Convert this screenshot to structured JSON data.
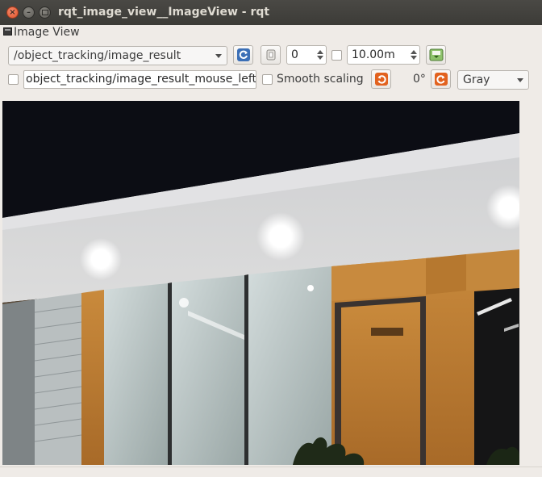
{
  "window": {
    "title": "rqt_image_view__ImageView - rqt",
    "close_glyph": "×",
    "minimize_glyph": "–"
  },
  "dock": {
    "title": "Image View"
  },
  "toolbar": {
    "topic": "/object_tracking/image_result",
    "refresh_icon": "refresh-icon",
    "zoom_value": "0",
    "max_range": "10.00m",
    "save_icon": "save-image-icon"
  },
  "row2": {
    "mouse_topic": "object_tracking/image_result_mouse_left",
    "smooth_label": "Smooth scaling",
    "rotation": "0°",
    "color_scheme": "Gray"
  },
  "colors": {
    "titlebar": "#3c3b37",
    "accent_refresh": "#3b6fb6",
    "accent_rotate": "#e2621f"
  }
}
